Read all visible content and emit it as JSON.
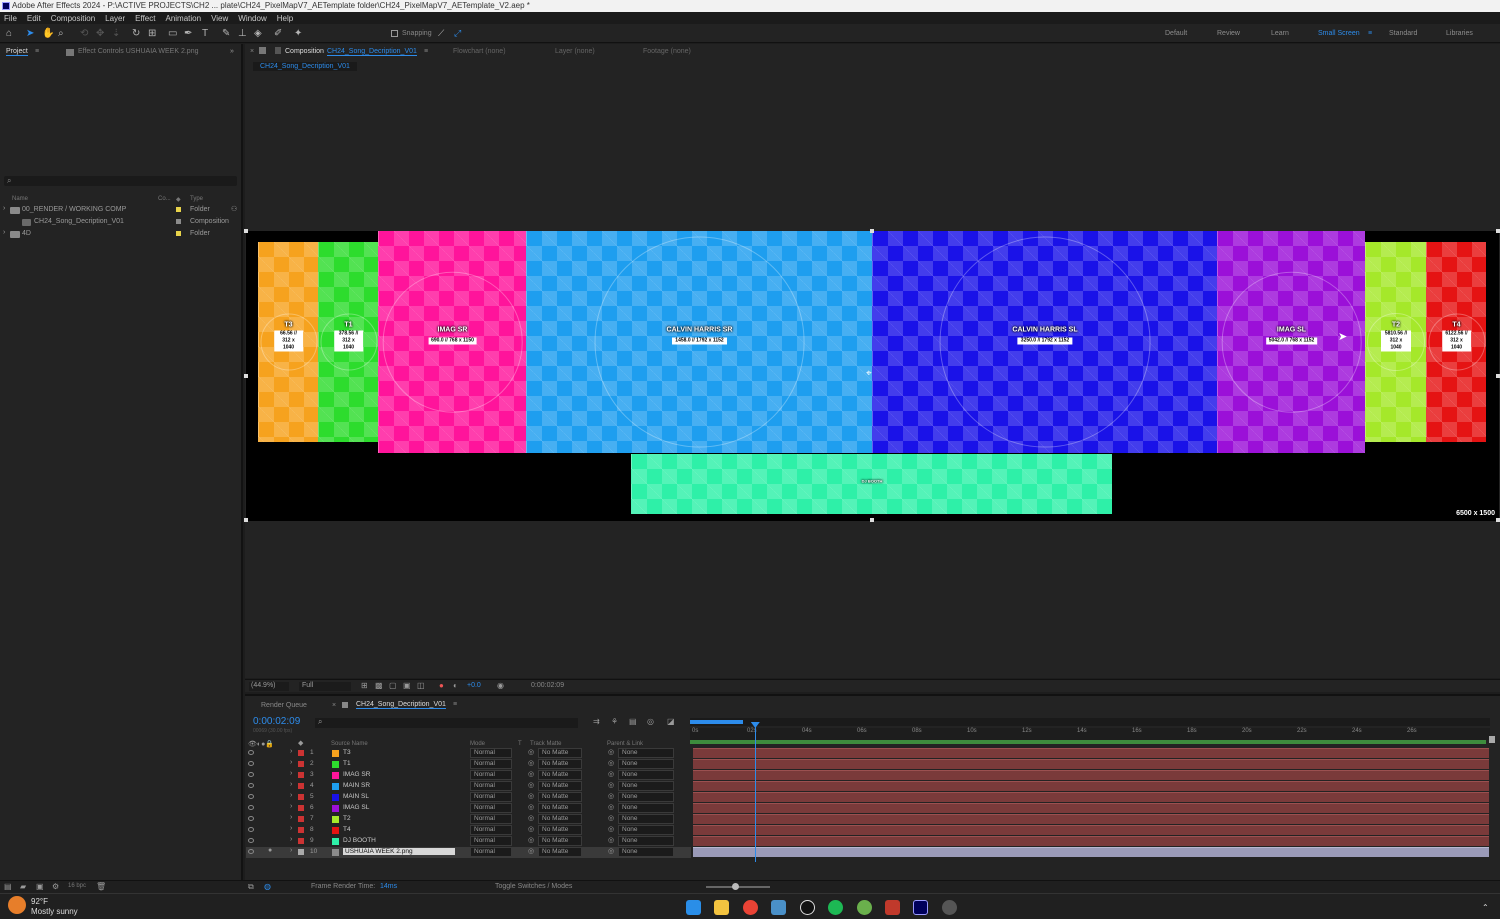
{
  "window": {
    "title": "Adobe After Effects 2024 - P:\\ACTIVE PROJECTS\\CH2 ... plate\\CH24_PixelMapV7_AETemplate folder\\CH24_PixelMapV7_AETemplate_V2.aep *"
  },
  "menu": [
    "File",
    "Edit",
    "Composition",
    "Layer",
    "Effect",
    "Animation",
    "View",
    "Window",
    "Help"
  ],
  "toolbar": {
    "snapping": "Snapping",
    "workspaces": [
      "Default",
      "Review",
      "Learn",
      "Small Screen",
      "Standard",
      "Libraries"
    ],
    "active_workspace": "Small Screen"
  },
  "project": {
    "tab_project": "Project",
    "tab_effect": "Effect Controls USHUAIA WEEK 2.png",
    "columns": {
      "name": "Name",
      "co": "Co...",
      "type": "Type"
    },
    "items": [
      {
        "name": "00_RENDER / WORKING COMP",
        "type": "Folder",
        "color": "#e8d34a"
      },
      {
        "name": "CH24_Song_Decription_V01",
        "type": "Composition",
        "color": "#8b8b8b"
      },
      {
        "name": "4D",
        "type": "Folder",
        "color": "#e8d34a"
      }
    ]
  },
  "composition": {
    "tab_label": "Composition",
    "comp_name": "CH24_Song_Decription_V01",
    "flowchart": "Flowchart (none)",
    "layer": "Layer (none)",
    "footage": "Footage (none)",
    "breadcrumb": "CH24_Song_Decription_V01",
    "canvas_size_label": "6500 x 1500",
    "screens": [
      {
        "name": "T3",
        "dims": "66.56 // 312 x 1040",
        "color": "#f6a21e"
      },
      {
        "name": "T1",
        "dims": "378.56 // 312 x 1040",
        "color": "#2ddc2d"
      },
      {
        "name": "IMAG SR",
        "dims": "690.0 // 768 x 1150",
        "color": "#ff149b"
      },
      {
        "name": "CALVIN HARRIS SR",
        "dims": "1458.0 // 1792 x 1152",
        "color": "#1e9eef"
      },
      {
        "name": "CALVIN HARRIS SL",
        "dims": "3250.0 // 1792 x 1152",
        "color": "#1a12e8"
      },
      {
        "name": "IMAG SL",
        "dims": "5042.0 // 768 x 1152",
        "color": "#9b10d8"
      },
      {
        "name": "T2",
        "dims": "5810.56 // 312 x 1040",
        "color": "#a5e82a"
      },
      {
        "name": "T4",
        "dims": "6122.56 // 312 x 1040",
        "color": "#e51313"
      },
      {
        "name": "DJ BOOTH",
        "dims": "",
        "color": "#2ef0a8"
      }
    ]
  },
  "viewer": {
    "zoom": "(44.9%)",
    "resolution": "Full",
    "exposure": "+0.0",
    "timecode": "0:00:02:09"
  },
  "timeline": {
    "render_queue": "Render Queue",
    "comp_tab": "CH24_Song_Decription_V01",
    "timecode": "0:00:02:09",
    "frame_info": "00069 (30.00 fps)",
    "columns": {
      "source_name": "Source Name",
      "mode": "Mode",
      "t": "T",
      "track_matte": "Track Matte",
      "parent": "Parent & Link"
    },
    "ruler": [
      "0s",
      "02s",
      "04s",
      "06s",
      "08s",
      "10s",
      "12s",
      "14s",
      "16s",
      "18s",
      "20s",
      "22s",
      "24s",
      "26s"
    ],
    "playhead_fraction": 0.081,
    "layers": [
      {
        "num": "1",
        "name": "T3",
        "color": "#f6a21e",
        "mode": "Normal",
        "matte": "No Matte",
        "parent": "None"
      },
      {
        "num": "2",
        "name": "T1",
        "color": "#2ddc2d",
        "mode": "Normal",
        "matte": "No Matte",
        "parent": "None"
      },
      {
        "num": "3",
        "name": "IMAG SR",
        "color": "#ff149b",
        "mode": "Normal",
        "matte": "No Matte",
        "parent": "None"
      },
      {
        "num": "4",
        "name": "MAIN SR",
        "color": "#1e9eef",
        "mode": "Normal",
        "matte": "No Matte",
        "parent": "None"
      },
      {
        "num": "5",
        "name": "MAIN SL",
        "color": "#1a12e8",
        "mode": "Normal",
        "matte": "No Matte",
        "parent": "None"
      },
      {
        "num": "6",
        "name": "IMAG SL",
        "color": "#9b10d8",
        "mode": "Normal",
        "matte": "No Matte",
        "parent": "None"
      },
      {
        "num": "7",
        "name": "T2",
        "color": "#a5e82a",
        "mode": "Normal",
        "matte": "No Matte",
        "parent": "None"
      },
      {
        "num": "8",
        "name": "T4",
        "color": "#e51313",
        "mode": "Normal",
        "matte": "No Matte",
        "parent": "None"
      },
      {
        "num": "9",
        "name": "DJ BOOTH",
        "color": "#2ef0a8",
        "mode": "Normal",
        "matte": "No Matte",
        "parent": "None"
      },
      {
        "num": "10",
        "name": "USHUAIA WEEK 2.png",
        "color": "#8b8b8b",
        "mode": "Normal",
        "matte": "No Matte",
        "parent": "None"
      }
    ]
  },
  "status": {
    "bpc": "16 bpc",
    "frame_render_label": "Frame Render Time:",
    "frame_render_value": "14ms",
    "toggle": "Toggle Switches / Modes"
  },
  "taskbar": {
    "temp": "92°F",
    "weather": "Mostly sunny"
  }
}
